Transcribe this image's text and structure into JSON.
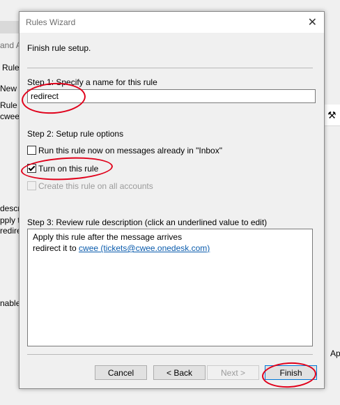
{
  "background": {
    "fragments": [
      "and A",
      "Rules",
      "New R",
      "Rule (a",
      "cwee (",
      "descr",
      "pply thi",
      "redirect i",
      "nable",
      "Ap"
    ]
  },
  "dialog": {
    "title": "Rules Wizard",
    "heading": "Finish rule setup.",
    "step1": {
      "label": "Step 1: Specify a name for this rule",
      "name_value": "redirect"
    },
    "step2": {
      "label": "Step 2: Setup rule options",
      "options": [
        {
          "label": "Run this rule now on messages already in \"Inbox\"",
          "checked": false,
          "enabled": true
        },
        {
          "label": "Turn on this rule",
          "checked": true,
          "enabled": true
        },
        {
          "label": "Create this rule on all accounts",
          "checked": false,
          "enabled": false
        }
      ]
    },
    "step3": {
      "label": "Step 3: Review rule description (click an underlined value to edit)",
      "line1": "Apply this rule after the message arrives",
      "line2_prefix": "redirect it to ",
      "line2_link": "cwee (tickets@cwee.onedesk.com)"
    },
    "buttons": {
      "cancel": "Cancel",
      "back": "< Back",
      "next": "Next >",
      "finish": "Finish"
    },
    "annotation_color": "#e0001a"
  }
}
